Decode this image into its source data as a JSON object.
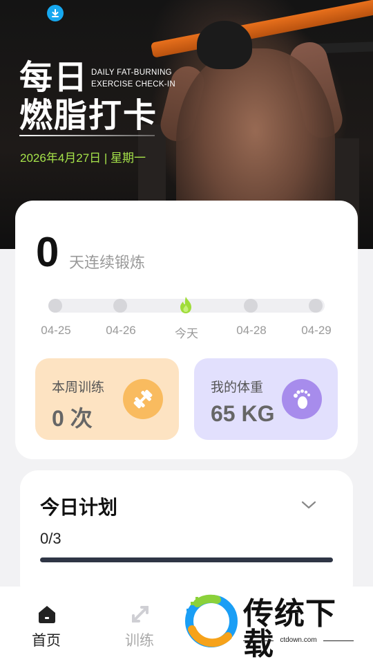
{
  "hero": {
    "title_line1": "每日",
    "title_line2": "燃脂打卡",
    "title_en_line1": "DAILY FAT-BURNING",
    "title_en_line2": "EXERCISE CHECK-IN",
    "date": "2026年4月27日 | 星期一",
    "download_icon": "download-icon",
    "accent_color": "#a6e34a"
  },
  "streak": {
    "count": "0",
    "label": "天连续锻炼"
  },
  "timeline": {
    "days": [
      {
        "label": "04-25",
        "state": "inactive"
      },
      {
        "label": "04-26",
        "state": "inactive"
      },
      {
        "label": "今天",
        "state": "today"
      },
      {
        "label": "04-28",
        "state": "inactive"
      },
      {
        "label": "04-29",
        "state": "inactive"
      }
    ]
  },
  "stats": {
    "training": {
      "label": "本周训练",
      "value": "0 次",
      "icon": "dumbbell-icon",
      "color": "#f9bb5f"
    },
    "weight": {
      "label": "我的体重",
      "value": "65 KG",
      "icon": "footprint-icon",
      "color": "#a78cec"
    }
  },
  "plan": {
    "title": "今日计划",
    "progress_text": "0/3",
    "progress": 0,
    "expand_icon": "chevron-down-icon"
  },
  "tabbar": {
    "tabs": [
      {
        "label": "首页",
        "icon": "home-icon",
        "active": true
      },
      {
        "label": "训练",
        "icon": "expand-arrows-icon",
        "active": false
      }
    ]
  },
  "watermark": {
    "text": "传统下载",
    "url": "ctdown.com"
  }
}
